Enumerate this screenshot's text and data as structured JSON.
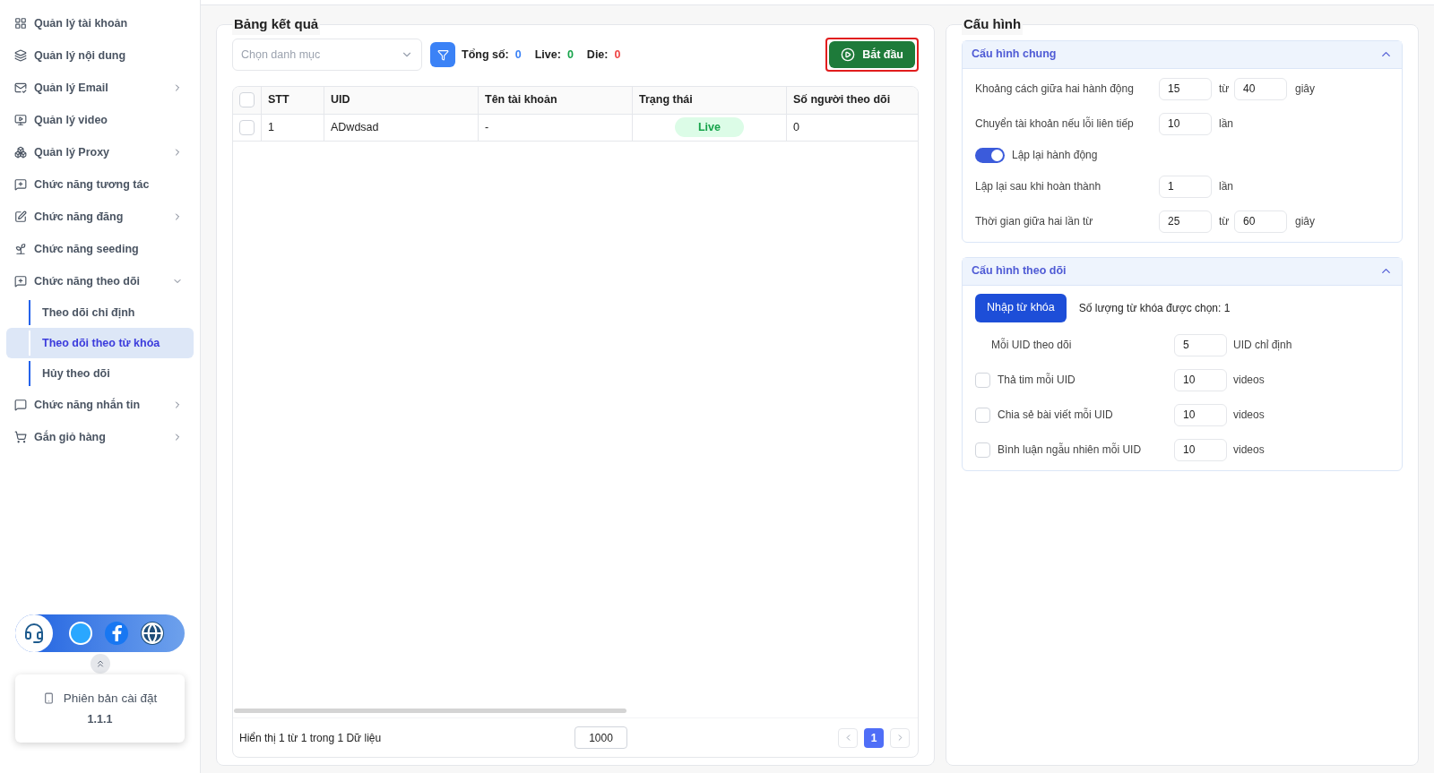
{
  "sidebar": {
    "items": [
      {
        "kind": "link",
        "label": "Quản lý tài khoản"
      },
      {
        "kind": "link",
        "label": "Quản lý nội dung"
      },
      {
        "kind": "group",
        "label": "Quản lý Email",
        "expanded": false
      },
      {
        "kind": "link",
        "label": "Quản lý video"
      },
      {
        "kind": "group",
        "label": "Quản lý Proxy",
        "expanded": false
      },
      {
        "kind": "link",
        "label": "Chức năng tương tác"
      },
      {
        "kind": "group",
        "label": "Chức năng đăng",
        "expanded": false
      },
      {
        "kind": "link",
        "label": "Chức năng seeding"
      },
      {
        "kind": "group",
        "label": "Chức năng theo dõi",
        "expanded": true,
        "children": [
          {
            "label": "Theo dõi chỉ định",
            "selected": false
          },
          {
            "label": "Theo dõi theo từ khóa",
            "selected": true
          },
          {
            "label": "Hủy theo dõi",
            "selected": false
          }
        ]
      },
      {
        "kind": "group",
        "label": "Chức năng nhắn tin",
        "expanded": false
      },
      {
        "kind": "group",
        "label": "Gắn giỏ hàng",
        "expanded": false
      }
    ],
    "version": {
      "label": "Phiên bản cài đặt",
      "value": "1.1.1"
    }
  },
  "results": {
    "title": "Bảng kết quả",
    "category_select": {
      "placeholder": "Chọn danh mục"
    },
    "counts": [
      {
        "label": "Tổng số:",
        "value": "0",
        "color": "#3b82f6"
      },
      {
        "label": "Live:",
        "value": "0",
        "color": "#16a34a"
      },
      {
        "label": "Die:",
        "value": "0",
        "color": "#ef4444"
      }
    ],
    "start_button": {
      "label": "Bắt đầu",
      "highlighted": true
    },
    "table": {
      "header_checked": false,
      "columns": [
        "STT",
        "UID",
        "Tên tài khoản",
        "Trạng thái",
        "Số người theo dõi"
      ],
      "rows": [
        {
          "checked": false,
          "stt": "1",
          "uid": "ADwdsad",
          "name": "-",
          "status": "Live",
          "followers": "0"
        }
      ]
    },
    "footer": {
      "summary": "Hiển thị 1 từ 1 trong 1 Dữ liệu",
      "page_size": "1000",
      "pages": [
        {
          "label": "1",
          "selected": true
        }
      ]
    }
  },
  "config": {
    "title": "Cấu hình",
    "sections": [
      {
        "title": "Cấu hình chung",
        "expanded": true,
        "rows": [
          {
            "kind": "range",
            "label": "Khoảng cách giữa hai hành động",
            "from": "15",
            "sep": "từ",
            "to": "40",
            "unit": "giây"
          },
          {
            "kind": "number",
            "label": "Chuyển tài khoản nếu lỗi liên tiếp",
            "value": "10",
            "unit": "lần"
          },
          {
            "kind": "toggle",
            "label": "Lập lại hành động",
            "on": true
          },
          {
            "kind": "number",
            "label": "Lập lại sau khi hoàn thành",
            "value": "1",
            "unit": "lần"
          },
          {
            "kind": "range",
            "label": "Thời gian giữa hai lần từ",
            "from": "25",
            "sep": "từ",
            "to": "60",
            "unit": "giây"
          }
        ]
      },
      {
        "title": "Cấu hình theo dõi",
        "expanded": true,
        "button": "Nhập từ khóa",
        "selected_count": "Số lượng từ khóa được chọn: 1",
        "rows": [
          {
            "kind": "indented",
            "label": "Mỗi UID theo dõi",
            "value": "5",
            "unit": "UID chỉ định"
          },
          {
            "kind": "check",
            "checked": false,
            "label": "Thả tim mỗi UID",
            "value": "10",
            "unit": "videos"
          },
          {
            "kind": "check",
            "checked": false,
            "label": "Chia sẻ bài viết mỗi UID",
            "value": "10",
            "unit": "videos"
          },
          {
            "kind": "check",
            "checked": false,
            "label": "Bình luận ngẫu nhiên mỗi UID",
            "value": "10",
            "unit": "videos"
          }
        ]
      }
    ]
  }
}
